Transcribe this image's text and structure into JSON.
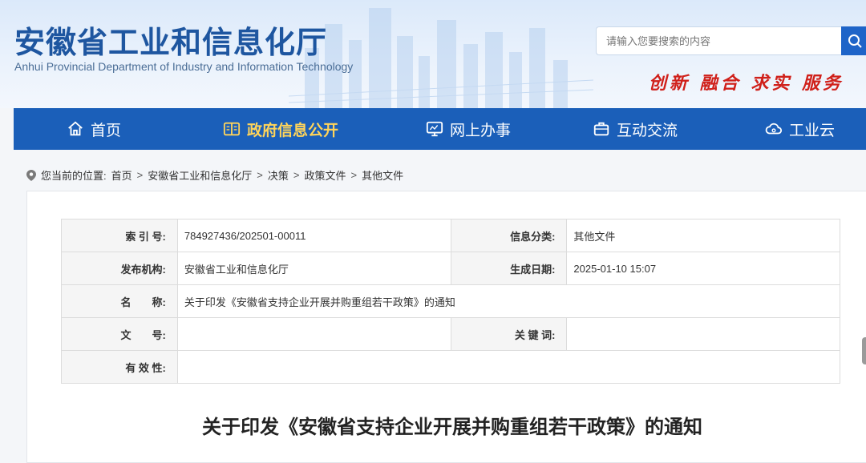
{
  "header": {
    "title": "安徽省工业和信息化厅",
    "subtitle": "Anhui Provincial Department of Industry and Information Technology",
    "slogan": "创新 融合 求实 服务",
    "search": {
      "placeholder": "请输入您要搜索的内容",
      "value": ""
    }
  },
  "nav": {
    "items": [
      {
        "label": "首页",
        "icon": "home-icon"
      },
      {
        "label": "政府信息公开",
        "icon": "book-icon",
        "active": true
      },
      {
        "label": "网上办事",
        "icon": "monitor-icon"
      },
      {
        "label": "互动交流",
        "icon": "briefcase-icon"
      },
      {
        "label": "工业云",
        "icon": "cloud-gear-icon"
      }
    ]
  },
  "breadcrumb": {
    "prefix": "您当前的位置:",
    "items": [
      "首页",
      "安徽省工业和信息化厅",
      "决策",
      "政策文件",
      "其他文件"
    ],
    "separator": ">"
  },
  "meta": {
    "index_label": "索 引 号:",
    "index_value": "784927436/202501-00011",
    "category_label": "信息分类:",
    "category_value": "其他文件",
    "publisher_label": "发布机构:",
    "publisher_value": "安徽省工业和信息化厅",
    "date_label": "生成日期:",
    "date_value": "2025-01-10 15:07",
    "name_label": "名　　称:",
    "name_value": "关于印发《安徽省支持企业开展并购重组若干政策》的通知",
    "docno_label": "文　　号:",
    "docno_value": "",
    "keywords_label": "关 键 词:",
    "keywords_value": "",
    "validity_label": "有 效 性:",
    "validity_value": ""
  },
  "document": {
    "title": "关于印发《安徽省支持企业开展并购重组若干政策》的通知"
  },
  "colors": {
    "brand_blue": "#1b5fb9",
    "active_nav": "#ffd45a",
    "slogan_red": "#d0201a"
  }
}
